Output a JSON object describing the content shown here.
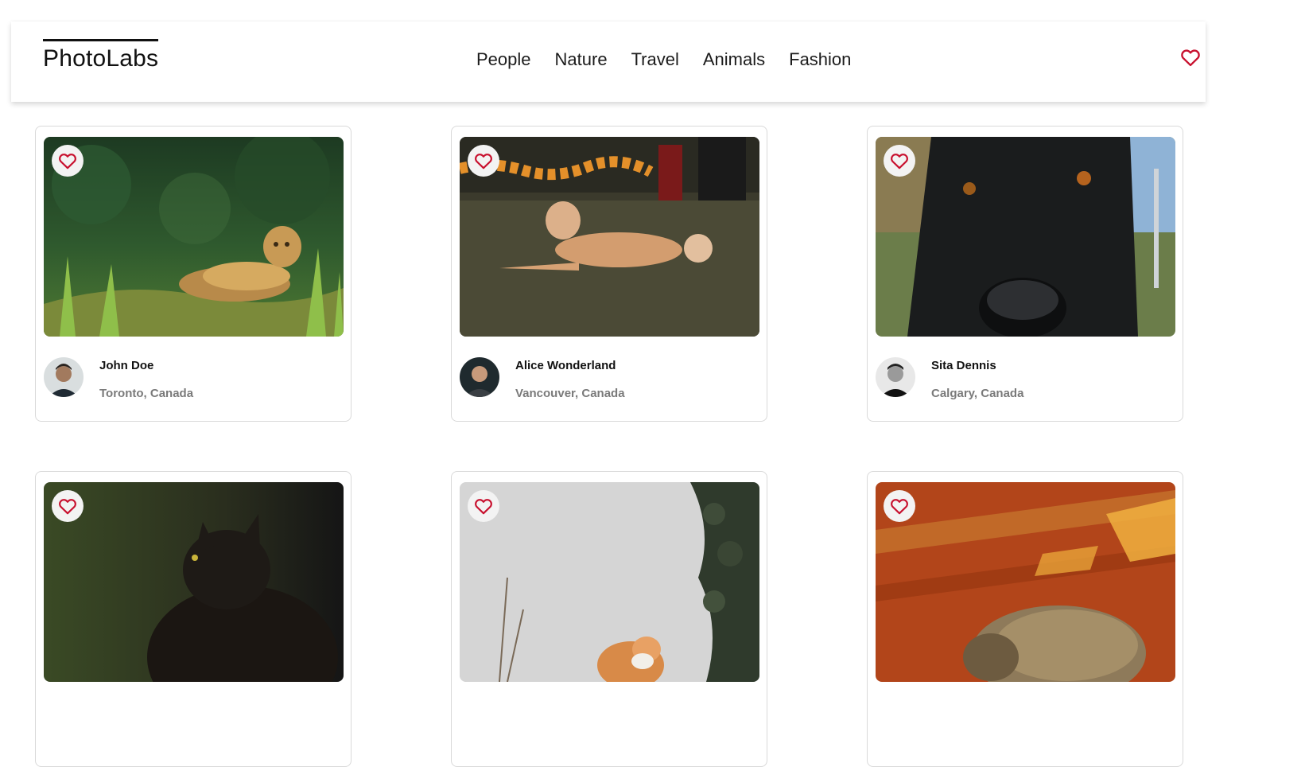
{
  "app": {
    "logo": "PhotoLabs",
    "accent_color": "#c8102e"
  },
  "nav": {
    "topics": [
      {
        "label": "People"
      },
      {
        "label": "Nature"
      },
      {
        "label": "Travel"
      },
      {
        "label": "Animals"
      },
      {
        "label": "Fashion"
      }
    ],
    "favourites_icon": "heart-outline-icon"
  },
  "photos": [
    {
      "photo": "jaguar-in-grass",
      "user": "John Doe",
      "location": "Toronto, Canada",
      "fav_icon": "heart-outline-icon"
    },
    {
      "photo": "dog-lying-on-grass",
      "user": "Alice Wonderland",
      "location": "Vancouver, Canada",
      "fav_icon": "heart-outline-icon"
    },
    {
      "photo": "black-dog-closeup",
      "user": "Sita Dennis",
      "location": "Calgary, Canada",
      "fav_icon": "heart-outline-icon"
    },
    {
      "photo": "black-cat",
      "user": "",
      "location": "",
      "fav_icon": "heart-outline-icon"
    },
    {
      "photo": "orange-cat-by-wall",
      "user": "",
      "location": "",
      "fav_icon": "heart-outline-icon"
    },
    {
      "photo": "tabby-cat-on-rug",
      "user": "",
      "location": "",
      "fav_icon": "heart-outline-icon"
    }
  ]
}
